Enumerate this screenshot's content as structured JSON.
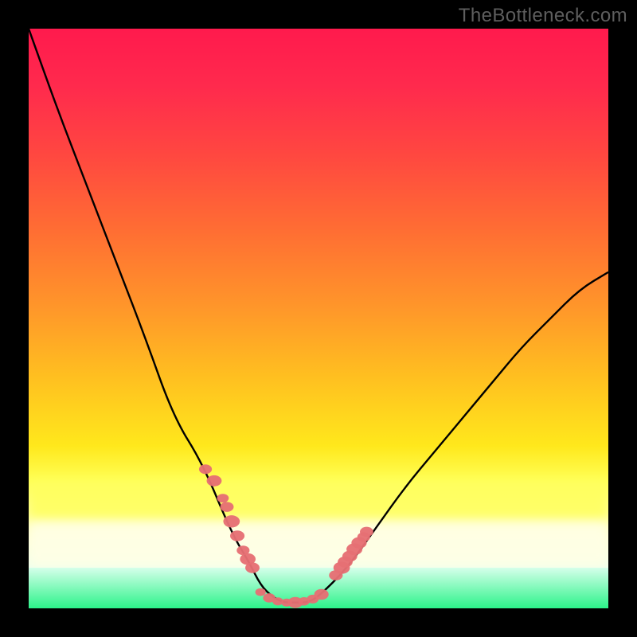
{
  "watermark": "TheBottleneck.com",
  "colors": {
    "curve_stroke": "#000000",
    "marker_fill": "#e66f74",
    "background_black": "#000000"
  },
  "chart_data": {
    "type": "line",
    "title": "",
    "xlabel": "",
    "ylabel": "",
    "xlim": [
      0,
      100
    ],
    "ylim": [
      0,
      100
    ],
    "x": [
      0,
      5,
      10,
      15,
      20,
      25,
      30,
      35,
      38,
      40,
      42,
      44,
      46,
      48,
      50,
      55,
      60,
      65,
      70,
      75,
      80,
      85,
      90,
      95,
      100
    ],
    "values": [
      100,
      86,
      73,
      60,
      47,
      33,
      25,
      13,
      8,
      4,
      2,
      1,
      1,
      1,
      2,
      7,
      14,
      21,
      27,
      33,
      39,
      45,
      50,
      55,
      58
    ],
    "markers": {
      "left_cluster_x": [
        30.5,
        32,
        33.5,
        34.2,
        35,
        36,
        37,
        37.8,
        38.6
      ],
      "left_cluster_y": [
        24,
        22,
        19,
        17.5,
        15,
        12.5,
        10,
        8.5,
        7
      ],
      "bottom_cluster_x": [
        40,
        41.5,
        43,
        44.5,
        46,
        47.5,
        49,
        50.5
      ],
      "bottom_cluster_y": [
        2.8,
        1.8,
        1.2,
        1.0,
        1.0,
        1.2,
        1.6,
        2.4
      ],
      "right_cluster_x": [
        53,
        54,
        54.6,
        55.4,
        56.2,
        57,
        57.8,
        58.3
      ],
      "right_cluster_y": [
        5.7,
        7,
        8,
        9,
        10.2,
        11.3,
        12.3,
        13.2
      ]
    }
  }
}
